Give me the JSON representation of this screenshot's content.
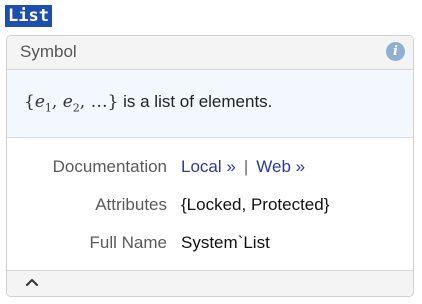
{
  "query": {
    "label": "List"
  },
  "card": {
    "title": "Symbol",
    "info_icon": "info-icon",
    "usage": {
      "expr_open": "{",
      "e1": "e",
      "sub1": "1",
      "comma1": ", ",
      "e2": "e",
      "sub2": "2",
      "comma2": ", …}",
      "text": " is a list of elements."
    },
    "details": {
      "documentation_label": "Documentation",
      "local_link": "Local »",
      "separator": "|",
      "web_link": "Web »",
      "attributes_label": "Attributes",
      "attributes_value": "{Locked, Protected}",
      "fullname_label": "Full Name",
      "fullname_value": "System`List"
    },
    "footer": {
      "collapse_icon": "chevron-up-icon"
    }
  }
}
